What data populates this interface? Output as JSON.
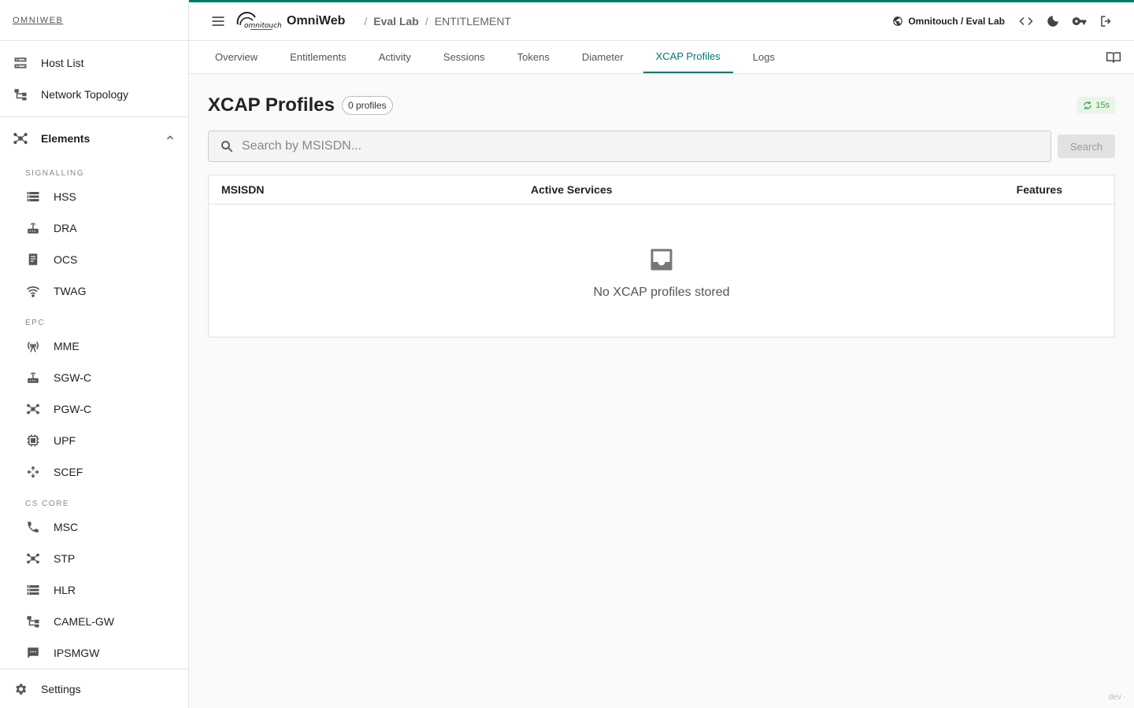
{
  "sidebar": {
    "brand": "OMNIWEB",
    "top_items": [
      {
        "label": "Host List",
        "icon": "server-list-icon"
      },
      {
        "label": "Network Topology",
        "icon": "topology-icon"
      }
    ],
    "elements_label": "Elements",
    "sections": [
      {
        "label": "SIGNALLING",
        "items": [
          {
            "label": "HSS",
            "icon": "storage-icon"
          },
          {
            "label": "DRA",
            "icon": "router-icon"
          },
          {
            "label": "OCS",
            "icon": "billing-icon"
          },
          {
            "label": "TWAG",
            "icon": "wifi-icon"
          }
        ]
      },
      {
        "label": "EPC",
        "items": [
          {
            "label": "MME",
            "icon": "antenna-icon"
          },
          {
            "label": "SGW-C",
            "icon": "router-icon"
          },
          {
            "label": "PGW-C",
            "icon": "hub-icon"
          },
          {
            "label": "UPF",
            "icon": "chip-icon"
          },
          {
            "label": "SCEF",
            "icon": "move-icon"
          }
        ]
      },
      {
        "label": "CS CORE",
        "items": [
          {
            "label": "MSC",
            "icon": "phone-icon"
          },
          {
            "label": "STP",
            "icon": "hub-icon"
          },
          {
            "label": "HLR",
            "icon": "storage-icon"
          },
          {
            "label": "CAMEL-GW",
            "icon": "topology-icon"
          },
          {
            "label": "IPSMGW",
            "icon": "message-icon"
          }
        ]
      }
    ],
    "settings_label": "Settings"
  },
  "topbar": {
    "app_name": "OmniWeb",
    "breadcrumb": [
      "Eval Lab",
      "ENTITLEMENT"
    ],
    "tenant": "Omnitouch / Eval Lab"
  },
  "tabs": [
    {
      "label": "Overview",
      "active": false
    },
    {
      "label": "Entitlements",
      "active": false
    },
    {
      "label": "Activity",
      "active": false
    },
    {
      "label": "Sessions",
      "active": false
    },
    {
      "label": "Tokens",
      "active": false
    },
    {
      "label": "Diameter",
      "active": false
    },
    {
      "label": "XCAP Profiles",
      "active": true
    },
    {
      "label": "Logs",
      "active": false
    }
  ],
  "main": {
    "title": "XCAP Profiles",
    "count_badge": "0 profiles",
    "refresh_badge": "15s",
    "search": {
      "placeholder": "Search by MSISDN...",
      "value": "",
      "button_label": "Search"
    },
    "table": {
      "columns": [
        "MSISDN",
        "Active Services",
        "Features"
      ],
      "rows": [],
      "empty_text": "No XCAP profiles stored"
    }
  },
  "footer_tag": "dev ·",
  "colors": {
    "accent": "#00796b",
    "refresh": "#43a047",
    "refresh_bg": "#e8f5e9"
  }
}
